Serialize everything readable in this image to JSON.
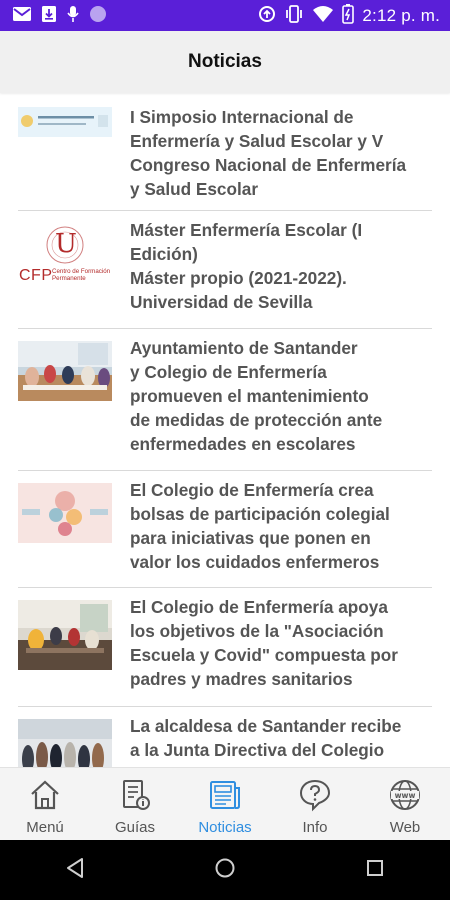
{
  "status_bar": {
    "time": "2:12 p. m.",
    "icons": [
      "gmail-icon",
      "download-icon",
      "mic-icon",
      "notification-dot-icon",
      "sync-icon",
      "vibrate-icon",
      "wifi-icon",
      "battery-icon"
    ]
  },
  "app_bar": {
    "title": "Noticias"
  },
  "news": [
    {
      "title": "I Simposio Internacional de\nEnfermería y Salud Escolar y V\nCongreso Nacional de Enfermería\ny Salud Escolar",
      "thumb": "simposio-banner-thumbnail"
    },
    {
      "title": "Máster Enfermería Escolar (I\nEdición)\nMáster propio (2021-2022).\nUniversidad de Sevilla",
      "thumb": "universidad-sevilla-cfp-logo",
      "logo_text": "CFP",
      "logo_sub": "Centro de Formación\nPermanente",
      "logo_mark": "U"
    },
    {
      "title": "Ayuntamiento de Santander\ny Colegio de Enfermería\npromueven el mantenimiento\nde medidas de protección ante\nenfermedades en escolares",
      "thumb": "meeting-photo"
    },
    {
      "title": "El Colegio de Enfermería crea\nbolsas de participación colegial\npara iniciativas que ponen en\nvalor los cuidados enfermeros",
      "thumb": "illustration-graphic"
    },
    {
      "title": "El Colegio de Enfermería apoya\nlos objetivos de la \"Asociación\nEscuela y Covid\" compuesta por\npadres y madres sanitarios",
      "thumb": "meeting-photo"
    },
    {
      "title": "La alcaldesa de Santander recibe\na la Junta  Directiva del Colegio",
      "thumb": "group-photo"
    }
  ],
  "bottom_nav": [
    {
      "label": "Menú",
      "icon": "home-icon",
      "active": false
    },
    {
      "label": "Guías",
      "icon": "guide-book-icon",
      "active": false
    },
    {
      "label": "Noticias",
      "icon": "newspaper-icon",
      "active": true
    },
    {
      "label": "Info",
      "icon": "help-chat-icon",
      "active": false
    },
    {
      "label": "Web",
      "icon": "www-globe-icon",
      "active": false
    }
  ],
  "colors": {
    "status_bar": "#5a1fd8",
    "active_nav": "#2f8ee0",
    "title_text": "#555555"
  },
  "system_nav": {
    "buttons": [
      "back-icon",
      "home-circle-icon",
      "recents-icon"
    ]
  }
}
